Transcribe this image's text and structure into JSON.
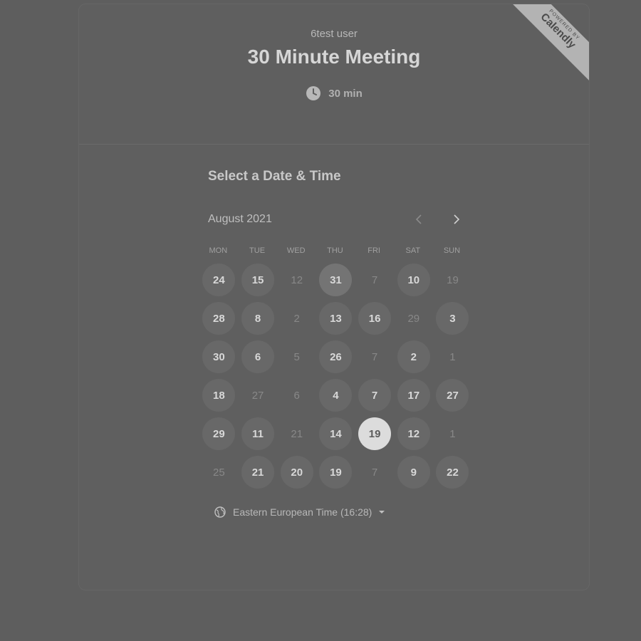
{
  "header": {
    "owner": "6test user",
    "title": "30 Minute Meeting",
    "duration": "30 min"
  },
  "ribbon": {
    "pre": "POWERED BY",
    "brand": "Calendly"
  },
  "calendar": {
    "section_title": "Select a Date & Time",
    "month": "August 2021",
    "weekdays": [
      "MON",
      "TUE",
      "WED",
      "THU",
      "FRI",
      "SAT",
      "SUN"
    ],
    "rows": [
      [
        {
          "d": "24",
          "s": "a"
        },
        {
          "d": "15",
          "s": "a"
        },
        {
          "d": "12",
          "s": "o"
        },
        {
          "d": "31",
          "s": "h"
        },
        {
          "d": "7",
          "s": "o"
        },
        {
          "d": "10",
          "s": "a"
        },
        {
          "d": "19",
          "s": "o"
        }
      ],
      [
        {
          "d": "28",
          "s": "a"
        },
        {
          "d": "8",
          "s": "a"
        },
        {
          "d": "2",
          "s": "o"
        },
        {
          "d": "13",
          "s": "a"
        },
        {
          "d": "16",
          "s": "a"
        },
        {
          "d": "29",
          "s": "o"
        },
        {
          "d": "3",
          "s": "a"
        }
      ],
      [
        {
          "d": "30",
          "s": "a"
        },
        {
          "d": "6",
          "s": "a"
        },
        {
          "d": "5",
          "s": "o"
        },
        {
          "d": "26",
          "s": "a"
        },
        {
          "d": "7",
          "s": "o"
        },
        {
          "d": "2",
          "s": "a"
        },
        {
          "d": "1",
          "s": "o"
        }
      ],
      [
        {
          "d": "18",
          "s": "a"
        },
        {
          "d": "27",
          "s": "o"
        },
        {
          "d": "6",
          "s": "o"
        },
        {
          "d": "4",
          "s": "a"
        },
        {
          "d": "7",
          "s": "a"
        },
        {
          "d": "17",
          "s": "a"
        },
        {
          "d": "27",
          "s": "a"
        }
      ],
      [
        {
          "d": "29",
          "s": "a"
        },
        {
          "d": "11",
          "s": "a"
        },
        {
          "d": "21",
          "s": "o"
        },
        {
          "d": "14",
          "s": "a"
        },
        {
          "d": "19",
          "s": "sel"
        },
        {
          "d": "12",
          "s": "a"
        },
        {
          "d": "1",
          "s": "o"
        }
      ],
      [
        {
          "d": "25",
          "s": "o"
        },
        {
          "d": "21",
          "s": "a"
        },
        {
          "d": "20",
          "s": "a"
        },
        {
          "d": "19",
          "s": "a"
        },
        {
          "d": "7",
          "s": "o"
        },
        {
          "d": "9",
          "s": "a"
        },
        {
          "d": "22",
          "s": "a"
        }
      ]
    ]
  },
  "timezone": {
    "label": "Eastern European Time (16:28)"
  }
}
